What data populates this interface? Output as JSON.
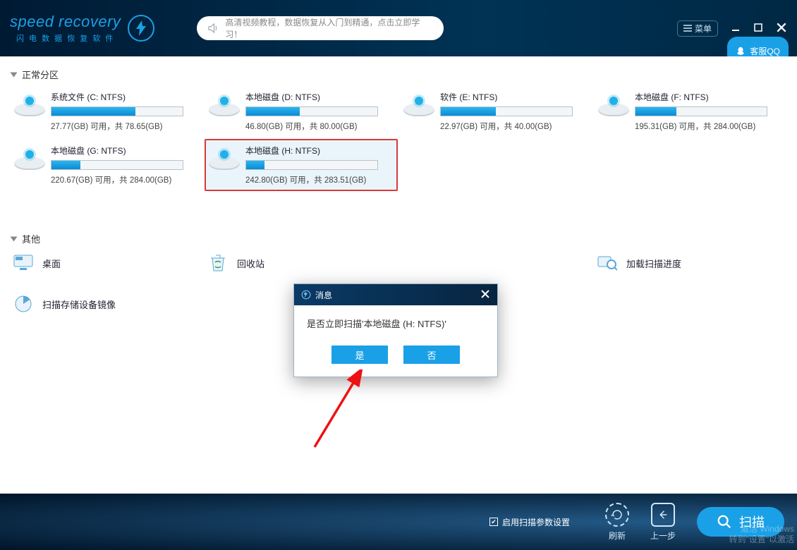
{
  "header": {
    "logo_main": "speed recovery",
    "logo_sub": "闪 电 数 据 恢 复 软 件",
    "tutorial_text": "高清视频教程，数据恢复从入门到精通，点击立即学习！",
    "menu_label": "菜单",
    "qq_label": "客服QQ"
  },
  "sections": {
    "normal_title": "正常分区",
    "other_title": "其他"
  },
  "partitions": [
    {
      "title": "系统文件 (C: NTFS)",
      "free": "27.77(GB)",
      "total": "78.65(GB)",
      "fill_pct": 64,
      "selected": false
    },
    {
      "title": "本地磁盘 (D: NTFS)",
      "free": "46.80(GB)",
      "total": "80.00(GB)",
      "fill_pct": 41,
      "selected": false
    },
    {
      "title": "软件 (E: NTFS)",
      "free": "22.97(GB)",
      "total": "40.00(GB)",
      "fill_pct": 42,
      "selected": false
    },
    {
      "title": "本地磁盘 (F: NTFS)",
      "free": "195.31(GB)",
      "total": "284.00(GB)",
      "fill_pct": 31,
      "selected": false
    },
    {
      "title": "本地磁盘 (G: NTFS)",
      "free": "220.67(GB)",
      "total": "284.00(GB)",
      "fill_pct": 22,
      "selected": false
    },
    {
      "title": "本地磁盘 (H: NTFS)",
      "free": "242.80(GB)",
      "total": "283.51(GB)",
      "fill_pct": 14,
      "selected": true
    }
  ],
  "labels": {
    "usable": " 可用，共 "
  },
  "others": [
    {
      "name": "桌面",
      "icon": "desktop"
    },
    {
      "name": "回收站",
      "icon": "recycle"
    },
    {
      "name": "加载扫描进度",
      "icon": "search"
    },
    {
      "name": "扫描存储设备镜像",
      "icon": "pie"
    }
  ],
  "modal": {
    "title": "消息",
    "body": "是否立即扫描'本地磁盘 (H: NTFS)'",
    "yes": "是",
    "no": "否"
  },
  "footer": {
    "checkbox_label": "启用扫描参数设置",
    "refresh": "刷新",
    "back": "上一步",
    "scan": "扫描"
  },
  "watermark": {
    "line1": "激活 Windows",
    "line2": "转到\"设置\"以激活"
  }
}
